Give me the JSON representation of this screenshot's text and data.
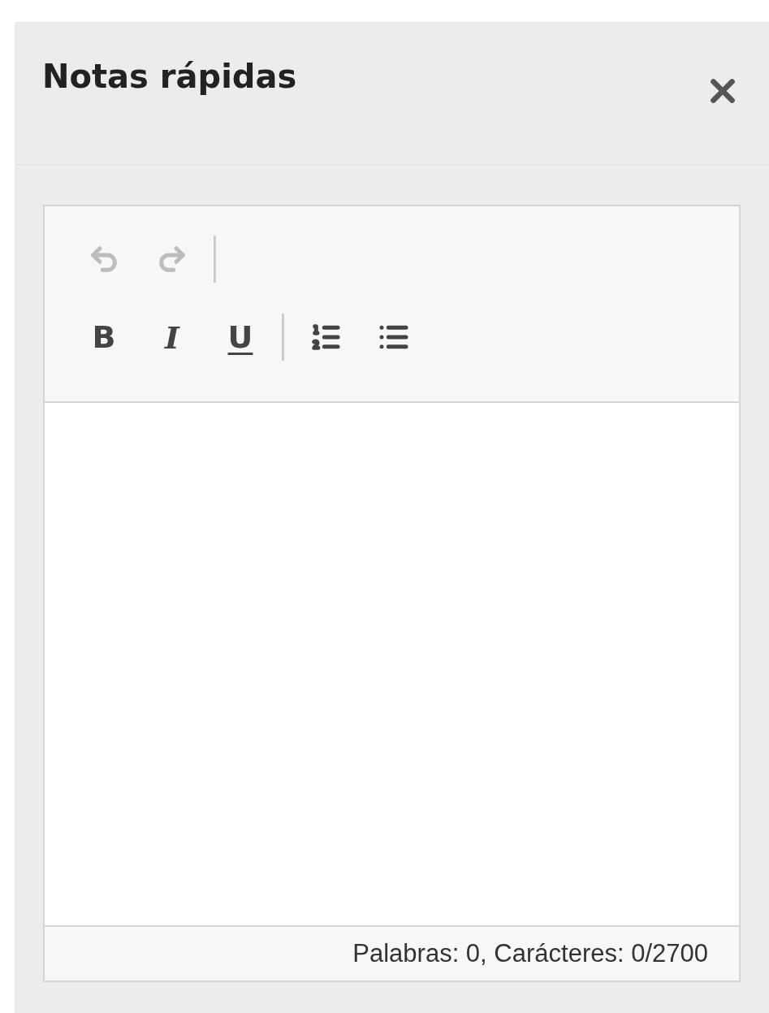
{
  "panel": {
    "title": "Notas rápidas"
  },
  "toolbar": {
    "rows": [
      [
        {
          "kind": "undo",
          "disabled": true
        },
        {
          "kind": "redo",
          "disabled": true
        }
      ],
      [
        {
          "kind": "bold",
          "label": "B",
          "disabled": false
        },
        {
          "kind": "italic",
          "label": "I",
          "disabled": false
        },
        {
          "kind": "underline",
          "label": "U",
          "disabled": false
        },
        {
          "kind": "separator"
        },
        {
          "kind": "ordered-list",
          "disabled": false
        },
        {
          "kind": "bullet-list",
          "disabled": false
        }
      ]
    ]
  },
  "status_bar": {
    "text": "Palabras: 0, Carácteres: 0/2700"
  }
}
